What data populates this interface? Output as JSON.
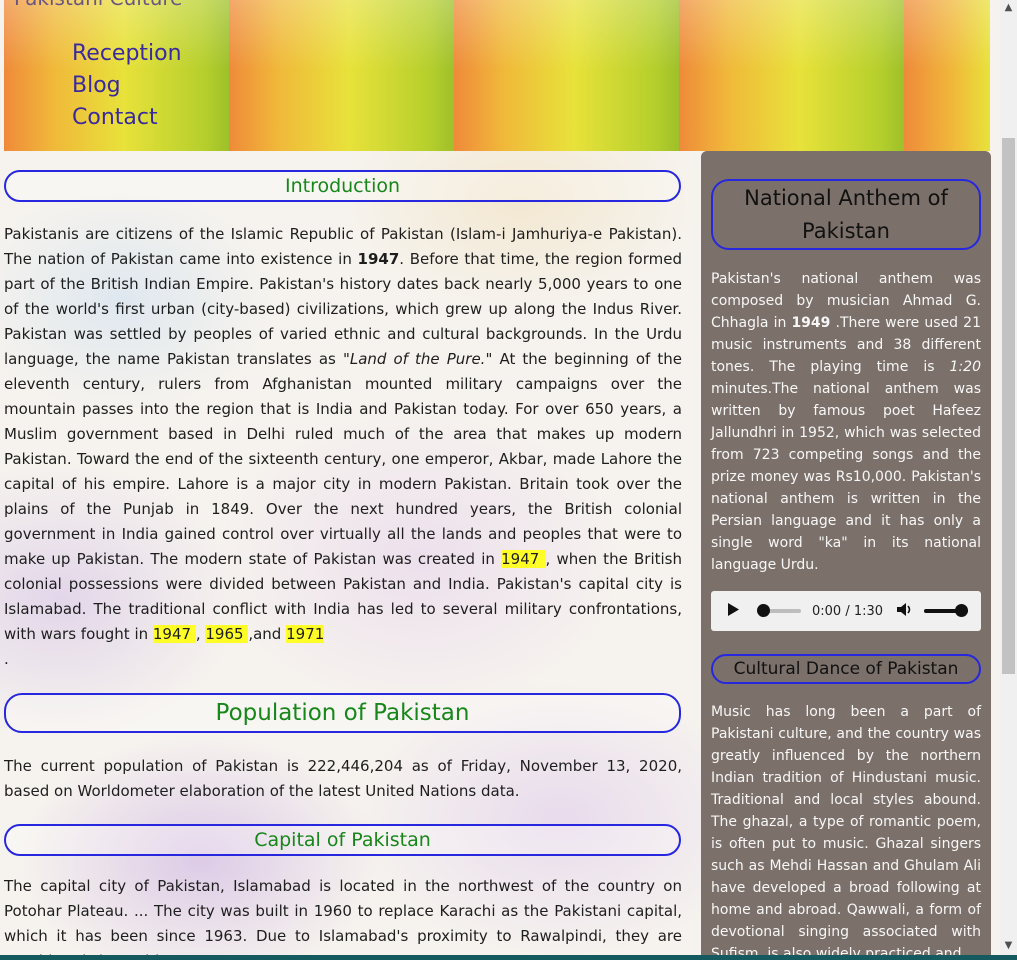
{
  "header": {
    "brand_fragment": "Pakistani Culture",
    "nav": [
      {
        "label": "Reception"
      },
      {
        "label": "Blog"
      },
      {
        "label": "Contact"
      }
    ]
  },
  "main": {
    "introduction": {
      "heading": "Introduction",
      "text_a": "Pakistanis are citizens of the Islamic Republic of Pakistan (Islam-i Jamhuriya-e Pakistan). The nation of Pakistan came into existence in ",
      "year_bold": "1947",
      "text_b": ". Before that time, the region formed part of the British Indian Empire. Pakistan's history dates back nearly 5,000 years to one of the world's first urban (city-based) civilizations, which grew up along the Indus River. Pakistan was settled by peoples of varied ethnic and cultural backgrounds. In the Urdu language, the name Pakistan translates as ",
      "quote": "\"Land of the Pure.\"",
      "text_c": " At the beginning of the eleventh century, rulers from Afghanistan mounted military campaigns over the mountain passes into the region that is India and Pakistan today. For over 650 years, a Muslim government based in Delhi ruled much of the area that makes up modern Pakistan. Toward the end of the sixteenth century, one emperor, Akbar, made Lahore the capital of his empire. Lahore is a major city in modern Pakistan. Britain took over the plains of the Punjab in 1849. Over the next hundred years, the British colonial government in India gained control over virtually all the lands and peoples that were to make up Pakistan. The modern state of Pakistan was created in ",
      "hl_1947a": "1947 ",
      "text_d": ", when the British colonial possessions were divided between Pakistan and India. Pakistan's capital city is Islamabad. The traditional conflict with India has led to several military confrontations, with wars fought in ",
      "hl_1947b": "1947 ",
      "sep1": ", ",
      "hl_1965": "1965 ",
      "sep2": ",and ",
      "hl_1971": "1971",
      "end": "."
    },
    "population": {
      "heading": "Population of Pakistan",
      "text": "The current population of Pakistan is 222,446,204 as of Friday, November 13, 2020, based on Worldometer elaboration of the latest United Nations data."
    },
    "capital": {
      "heading": "Capital of Pakistan",
      "text": "The capital city of Pakistan, Islamabad is located in the northwest of the country on Potohar Plateau. ... The city was built in 1960 to replace Karachi as the Pakistani capital, which it has been since 1963. Due to Islamabad's proximity to Rawalpindi, they are considered sister cities."
    }
  },
  "aside": {
    "anthem": {
      "heading": "National Anthem of Pakistan",
      "text_a": "Pakistan's national anthem was composed by musician Ahmad G. Chhagla in ",
      "year_bold": "1949",
      "text_b": " .There were used 21 music instruments and 38 different tones. The playing time is ",
      "time_italic": "1:20",
      "text_c": " minutes.The national anthem was written by famous poet Hafeez Jallundhri in 1952, which was selected from 723 competing songs and the prize money was Rs10,000. Pakistan's national anthem is written in the Persian language and it has only a single word \"ka\" in its national language Urdu."
    },
    "player": {
      "time": "0:00 / 1:30",
      "progress_fraction": 0.0,
      "volume_fraction": 1.0
    },
    "dance": {
      "heading": "Cultural Dance of Pakistan",
      "text": "Music has long been a part of Pakistani culture, and the country was greatly influenced by the northern Indian tradition of Hindustani music. Traditional and local styles abound. The ghazal, a type of romantic poem, is often put to music. Ghazal singers such as Mehdi Hassan and Ghulam Ali have developed a broad following at home and abroad. Qawwali, a form of devotional singing associated with Sufism, is also widely practiced and"
    }
  }
}
